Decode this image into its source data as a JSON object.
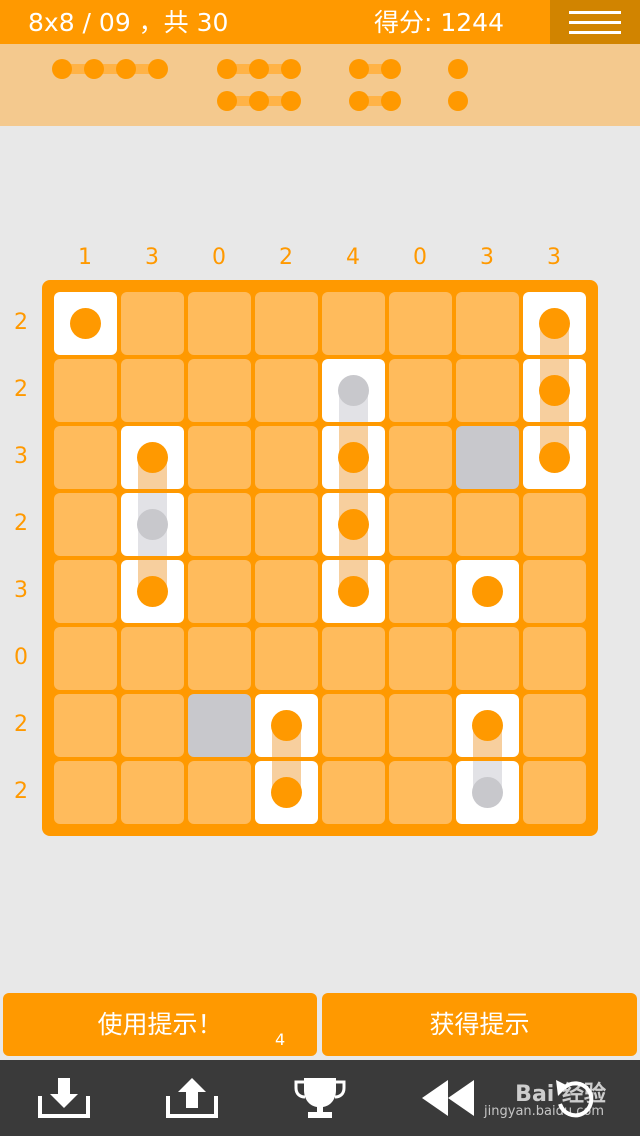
{
  "header": {
    "level_text": "8x8 / 09 ，共 30",
    "score_text": "得分: 1244"
  },
  "fleet": [
    {
      "size": 4
    },
    {
      "size": 3
    },
    {
      "size": 3
    },
    {
      "size": 2
    },
    {
      "size": 2
    },
    {
      "size": 1
    },
    {
      "size": 1
    }
  ],
  "column_clues": [
    "1",
    "3",
    "0",
    "2",
    "4",
    "0",
    "3",
    "3"
  ],
  "row_clues": [
    "2",
    "2",
    "3",
    "2",
    "3",
    "0",
    "2",
    "2"
  ],
  "grid": [
    [
      "ship-single",
      "unknown",
      "unknown",
      "unknown",
      "unknown",
      "unknown",
      "unknown",
      "ship-top"
    ],
    [
      "unknown",
      "unknown",
      "unknown",
      "unknown",
      "ship-top-hint",
      "unknown",
      "unknown",
      "ship-middle"
    ],
    [
      "unknown",
      "ship-top",
      "unknown",
      "unknown",
      "ship-middle",
      "unknown",
      "water",
      "ship-bottom"
    ],
    [
      "unknown",
      "ship-middle-hint",
      "unknown",
      "unknown",
      "ship-middle",
      "unknown",
      "unknown",
      "unknown"
    ],
    [
      "unknown",
      "ship-bottom",
      "unknown",
      "unknown",
      "ship-bottom",
      "unknown",
      "ship-single",
      "unknown"
    ],
    [
      "unknown",
      "unknown",
      "unknown",
      "unknown",
      "unknown",
      "unknown",
      "unknown",
      "unknown"
    ],
    [
      "unknown",
      "unknown",
      "water",
      "ship-top",
      "unknown",
      "unknown",
      "ship-top",
      "unknown"
    ],
    [
      "unknown",
      "unknown",
      "unknown",
      "ship-bottom",
      "unknown",
      "unknown",
      "ship-bottom-hint",
      "unknown"
    ]
  ],
  "buttons": {
    "use_hint": "使用提示！",
    "use_hint_count": "4",
    "get_hint": "获得提示"
  },
  "toolbar": {
    "icons": [
      "download-icon",
      "upload-icon",
      "trophy-icon",
      "rewind-icon",
      "undo-icon"
    ]
  },
  "watermark": {
    "text": "Bai 经验",
    "sub": "jingyan.baidu.com"
  },
  "colors": {
    "accent": "#ff9900",
    "cell": "#ffbb5c",
    "ship_cell": "#ffffff",
    "water": "#c8c8cc",
    "toolbar": "#3a3a3a"
  }
}
